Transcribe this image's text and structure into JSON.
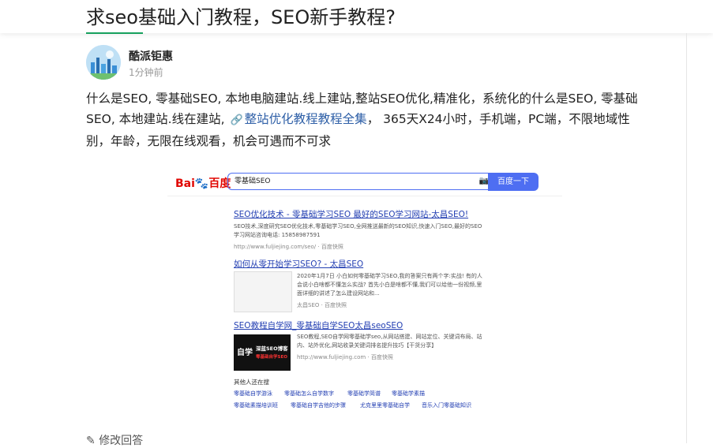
{
  "header": {
    "title": "求seo基础入门教程，SEO新手教程?"
  },
  "author": {
    "name": "酷派钜惠",
    "time": "1分钟前"
  },
  "answer": {
    "text_1": "什么是SEO, 零基础SEO, 本地电脑建站.线上建站,整站SEO优化,精准化，系统化的什么是SEO, 零基础SEO, 本地建站.线在建站,",
    "link_label": "整站优化教程教程全集",
    "text_2": "， 365天X24小时，手机端，PC端，不限地域性别，年龄，无限在线观看，机会可遇而不可求"
  },
  "screenshot": {
    "logo": "Bai",
    "logo_cn": "百度",
    "query": "零基础SEO",
    "search_button": "百度一下",
    "results": [
      {
        "title": "SEO优化技术 - 零基础学习SEO 最好的SEO学习网站-太昌SEO!",
        "snippet": "SEO技术,深度研究SEO优化技术,零基础学习SEO,全网推送最新的SEO知识,快速入门SEO,最好的SEO学习网站咨询电话: 15858987591",
        "url": "http://www.fuljiejing.com/seo/  ·  百度快照"
      },
      {
        "title": "如何从零开始学习SEO? - 太昌SEO",
        "snippet": "2020年1月7日 小白如何零基础学习SEO,我的答案只有两个字:实战! 有的人会说小白啥都不懂怎么实战? 首先小白是啥都不懂,我们可以给他一份视频,里面详细的讲述了怎么建设网站和...",
        "url": "太昌SEO  ·  百度快照"
      },
      {
        "title": "SEO教程自学网_零基础自学SEO太昌seoSEO",
        "snippet": "SEO教程,SEO自学网零基础学seo,从网站搭建、网站定位、关键词布局、站内、站外优化,网站收录关键词排名提升技巧【干货分享】",
        "url": "http://www.fuljiejing.com  ·  百度快照",
        "thumb_line1": "自学",
        "thumb_line2": "深蓝SEO博客",
        "thumb_line3": "零基础自学SEO"
      }
    ],
    "related_label": "其他人还在搜",
    "related": [
      "零基础自学游泳",
      "零基础怎么自学数字",
      "零基础学简谱",
      "零基础学素描",
      "零基础素描培训班",
      "零基础自学吉他的步骤",
      "尤克里里零基础自学",
      "音乐入门零基础知识"
    ]
  },
  "footer": {
    "edit_label": "修改回答"
  },
  "colors": {
    "accent": "#17a05d",
    "link": "#2e5fa7",
    "baidu_blue": "#4e6ef2",
    "baidu_red": "#f73131"
  }
}
